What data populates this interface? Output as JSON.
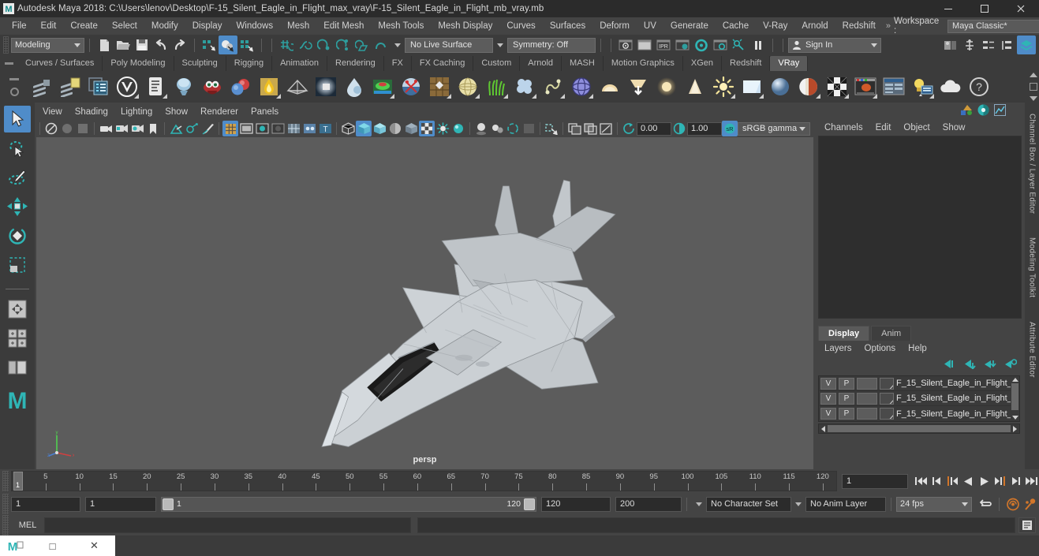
{
  "window": {
    "title": "Autodesk Maya 2018: C:\\Users\\lenov\\Desktop\\F-15_Silent_Eagle_in_Flight_max_vray\\F-15_Silent_Eagle_in_Flight_mb_vray.mb",
    "minimize": "–",
    "maximize": "❐",
    "close": "✕"
  },
  "menubar": {
    "items": [
      "File",
      "Edit",
      "Create",
      "Select",
      "Modify",
      "Display",
      "Windows",
      "Mesh",
      "Edit Mesh",
      "Mesh Tools",
      "Mesh Display",
      "Curves",
      "Surfaces",
      "Deform",
      "UV",
      "Generate",
      "Cache",
      "V-Ray",
      "Arnold",
      "Redshift"
    ],
    "overflow": "»",
    "workspace_label": "Workspace :",
    "workspace_value": "Maya Classic*"
  },
  "statusbar": {
    "menuset": "Modeling",
    "live_surface": "No Live Surface",
    "symmetry": "Symmetry: Off",
    "signin": "Sign In",
    "icons": [
      "new-scene-icon",
      "open-scene-icon",
      "save-scene-icon",
      "undo-icon",
      "redo-icon",
      "select-by-hierarchy-icon",
      "select-by-object-icon",
      "select-by-component-icon",
      "snap-to-grid-icon",
      "snap-to-curve-icon",
      "snap-to-point-icon",
      "snap-to-projected-center-icon",
      "snap-to-view-planes-icon",
      "make-live-icon",
      "render-current-frame-icon",
      "ipr-render-icon",
      "render-settings-icon",
      "hypershade-icon",
      "render-view-icon",
      "render-sequence-icon",
      "light-icon",
      "pause-icon",
      "sidebar-toggle-icon",
      "attribute-editor-icon",
      "tool-settings-icon",
      "channel-box-icon",
      "layer-editor-icon"
    ]
  },
  "shelf": {
    "tabs": [
      "Curves / Surfaces",
      "Poly Modeling",
      "Sculpting",
      "Rigging",
      "Animation",
      "Rendering",
      "FX",
      "FX Caching",
      "Custom",
      "Arnold",
      "MASH",
      "Motion Graphics",
      "XGen",
      "Redshift",
      "VRay"
    ],
    "active_tab": "VRay",
    "icons": [
      "vray-render-icon",
      "vray-render-options-icon",
      "vray-frame-buffer-icon",
      "vray-logo-icon",
      "vray-attributes-icon",
      "vray-mtl-icon",
      "vray-toon-icon",
      "vray-blend-icon",
      "vray-fire-icon",
      "vray-plane-icon",
      "vray-light-mtl-icon",
      "vray-fast-sss-icon",
      "vray-scatter-volume-icon",
      "vray-bump-mtl-icon",
      "vray-dirt-icon",
      "vray-sphere-icon",
      "vray-fur-icon",
      "vray-particle-icon",
      "vray-sphere-volume-icon",
      "vray-dome-light-icon",
      "vray-ies-light-icon",
      "vray-sun-icon",
      "vray-spot-light-icon",
      "vray-sky-light-icon",
      "vray-rect-light-icon",
      "vray-sphere-light-icon",
      "vray-mesh-light-icon",
      "vray-tex-checker-icon",
      "vray-proxy-icon",
      "vray-clipper-icon",
      "vray-scene-icon",
      "vray-cloud-icon",
      "vray-help-icon"
    ]
  },
  "tools": {
    "items": [
      "select-tool-icon",
      "lasso-select-tool-icon",
      "paint-select-tool-icon",
      "move-tool-icon",
      "rotate-tool-icon",
      "scale-tool-icon",
      "last-tool-icon",
      "single-view-layout-icon",
      "four-view-layout-icon",
      "outliner-layout-icon",
      "maya-logo-icon"
    ]
  },
  "viewport": {
    "menus": [
      "View",
      "Shading",
      "Lighting",
      "Show",
      "Renderer",
      "Panels"
    ],
    "camera_label": "persp",
    "exposure": "0.00",
    "gamma": "1.00",
    "color_profile": "sRGB gamma",
    "toolbar_icons": [
      "select-camera-icon",
      "lock-camera-icon",
      "camera-attributes-icon",
      "bookmark-icon",
      "grid-toggle-icon",
      "film-gate-icon",
      "resolution-gate-icon",
      "gate-mask-icon",
      "xray-icon",
      "xray-joints-icon",
      "texture-toggle-icon",
      "wireframe-icon",
      "shaded-icon",
      "shaded-textured-icon",
      "lights-icon",
      "shadows-icon",
      "ao-icon",
      "motion-blur-icon",
      "isolate-select-icon",
      "exposure-icon",
      "gamma-icon",
      "color-management-icon"
    ]
  },
  "rightpanel": {
    "top_icons": [
      "modeling-toolkit-icon",
      "attribute-editor-icon",
      "graph-editor-icon"
    ],
    "menus": [
      "Channels",
      "Edit",
      "Object",
      "Show"
    ],
    "tabs": [
      "Display",
      "Anim"
    ],
    "active_tab": "Display",
    "submenus": [
      "Layers",
      "Options",
      "Help"
    ],
    "layer_buttons": [
      "layer-prev-icon",
      "layer-next-icon",
      "layer-new-icon",
      "layer-new-from-selected-icon"
    ],
    "layers": [
      {
        "visible": "V",
        "playback": "P",
        "name": "F_15_Silent_Eagle_in_Flight_"
      },
      {
        "visible": "V",
        "playback": "P",
        "name": "F_15_Silent_Eagle_in_Flight_"
      },
      {
        "visible": "V",
        "playback": "P",
        "name": "F_15_Silent_Eagle_in_Flight_"
      }
    ],
    "vtabs": [
      "Channel Box / Layer Editor",
      "Modeling Toolkit",
      "Attribute Editor"
    ]
  },
  "timeline": {
    "ticks": [
      5,
      10,
      15,
      20,
      25,
      30,
      35,
      40,
      45,
      50,
      55,
      60,
      65,
      70,
      75,
      80,
      85,
      90,
      95,
      100,
      105,
      110,
      115,
      120
    ],
    "current_frame": "1",
    "playhead_label": "1",
    "playback_buttons": [
      "go-to-start-icon",
      "step-back-keyframe-icon",
      "step-back-frame-icon",
      "play-backwards-icon",
      "play-forwards-icon",
      "step-forward-frame-icon",
      "step-forward-keyframe-icon",
      "go-to-end-icon"
    ]
  },
  "rangebar": {
    "start_anim": "1",
    "start_range": "1",
    "slider_min": "1",
    "slider_max": "120",
    "end_range": "120",
    "end_anim": "200",
    "character_set": "No Character Set",
    "anim_layer": "No Anim Layer",
    "fps": "24 fps",
    "icons": [
      "loop-playback-icon",
      "auto-key-icon",
      "animation-preferences-icon"
    ]
  },
  "mel": {
    "label": "MEL",
    "input_value": "",
    "script_editor_button": "script-editor-icon"
  },
  "taskbar": {
    "app": "maya-taskbar-icon",
    "restore": "□",
    "close": "✕"
  },
  "colors": {
    "accent": "#4f8cc9",
    "viewport_bg": "#5c5c5c",
    "panel_bg": "#444444",
    "teal": "#23a8a8"
  }
}
